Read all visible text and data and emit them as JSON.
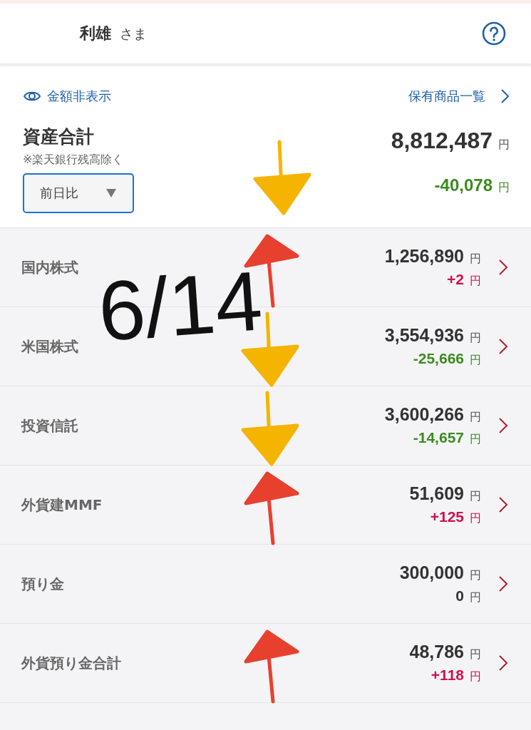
{
  "header": {
    "name": "利雄",
    "honorific": "さま"
  },
  "hide_amounts_link": "金額非表示",
  "holdings_link": "保有商品一覧",
  "total": {
    "title": "資産合計",
    "note": "※楽天銀行残高除く",
    "amount": "8,812,487",
    "unit": "円",
    "period_select": "前日比",
    "change": "-40,078",
    "change_unit": "円",
    "kind": "down",
    "doodle": {
      "kind": "down",
      "color": "#f5b400"
    }
  },
  "handwriting": "6/14",
  "rows": [
    {
      "label": "国内株式",
      "amount": "1,256,890",
      "unit": "円",
      "change": "+2",
      "change_unit": "円",
      "kind": "up",
      "doodle": {
        "kind": "up",
        "color": "#e8402f"
      }
    },
    {
      "label": "米国株式",
      "amount": "3,554,936",
      "unit": "円",
      "change": "-25,666",
      "change_unit": "円",
      "kind": "down",
      "doodle": {
        "kind": "down",
        "color": "#f5b400"
      }
    },
    {
      "label": "投資信託",
      "amount": "3,600,266",
      "unit": "円",
      "change": "-14,657",
      "change_unit": "円",
      "kind": "down",
      "doodle": {
        "kind": "down",
        "color": "#f5b400"
      }
    },
    {
      "label": "外貨建MMF",
      "amount": "51,609",
      "unit": "円",
      "change": "+125",
      "change_unit": "円",
      "kind": "up",
      "doodle": {
        "kind": "up",
        "color": "#e8402f"
      }
    },
    {
      "label": "預り金",
      "amount": "300,000",
      "unit": "円",
      "change": "0",
      "change_unit": "円",
      "kind": "flat"
    },
    {
      "label": "外貨預り金合計",
      "amount": "48,786",
      "unit": "円",
      "change": "+118",
      "change_unit": "円",
      "kind": "up",
      "doodle": {
        "kind": "up",
        "color": "#e8402f"
      }
    }
  ]
}
